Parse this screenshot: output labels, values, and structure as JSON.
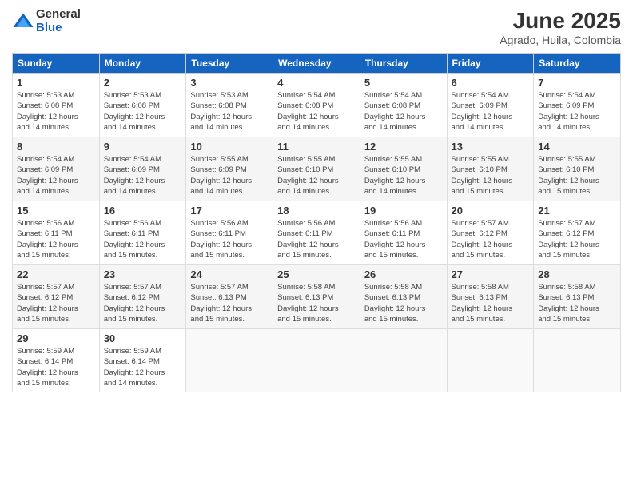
{
  "logo": {
    "general": "General",
    "blue": "Blue"
  },
  "title": {
    "month": "June 2025",
    "location": "Agrado, Huila, Colombia"
  },
  "weekdays": [
    "Sunday",
    "Monday",
    "Tuesday",
    "Wednesday",
    "Thursday",
    "Friday",
    "Saturday"
  ],
  "weeks": [
    [
      {
        "day": "1",
        "sunrise": "5:53 AM",
        "sunset": "6:08 PM",
        "daylight": "12 hours and 14 minutes."
      },
      {
        "day": "2",
        "sunrise": "5:53 AM",
        "sunset": "6:08 PM",
        "daylight": "12 hours and 14 minutes."
      },
      {
        "day": "3",
        "sunrise": "5:53 AM",
        "sunset": "6:08 PM",
        "daylight": "12 hours and 14 minutes."
      },
      {
        "day": "4",
        "sunrise": "5:54 AM",
        "sunset": "6:08 PM",
        "daylight": "12 hours and 14 minutes."
      },
      {
        "day": "5",
        "sunrise": "5:54 AM",
        "sunset": "6:08 PM",
        "daylight": "12 hours and 14 minutes."
      },
      {
        "day": "6",
        "sunrise": "5:54 AM",
        "sunset": "6:09 PM",
        "daylight": "12 hours and 14 minutes."
      },
      {
        "day": "7",
        "sunrise": "5:54 AM",
        "sunset": "6:09 PM",
        "daylight": "12 hours and 14 minutes."
      }
    ],
    [
      {
        "day": "8",
        "sunrise": "5:54 AM",
        "sunset": "6:09 PM",
        "daylight": "12 hours and 14 minutes."
      },
      {
        "day": "9",
        "sunrise": "5:54 AM",
        "sunset": "6:09 PM",
        "daylight": "12 hours and 14 minutes."
      },
      {
        "day": "10",
        "sunrise": "5:55 AM",
        "sunset": "6:09 PM",
        "daylight": "12 hours and 14 minutes."
      },
      {
        "day": "11",
        "sunrise": "5:55 AM",
        "sunset": "6:10 PM",
        "daylight": "12 hours and 14 minutes."
      },
      {
        "day": "12",
        "sunrise": "5:55 AM",
        "sunset": "6:10 PM",
        "daylight": "12 hours and 14 minutes."
      },
      {
        "day": "13",
        "sunrise": "5:55 AM",
        "sunset": "6:10 PM",
        "daylight": "12 hours and 15 minutes."
      },
      {
        "day": "14",
        "sunrise": "5:55 AM",
        "sunset": "6:10 PM",
        "daylight": "12 hours and 15 minutes."
      }
    ],
    [
      {
        "day": "15",
        "sunrise": "5:56 AM",
        "sunset": "6:11 PM",
        "daylight": "12 hours and 15 minutes."
      },
      {
        "day": "16",
        "sunrise": "5:56 AM",
        "sunset": "6:11 PM",
        "daylight": "12 hours and 15 minutes."
      },
      {
        "day": "17",
        "sunrise": "5:56 AM",
        "sunset": "6:11 PM",
        "daylight": "12 hours and 15 minutes."
      },
      {
        "day": "18",
        "sunrise": "5:56 AM",
        "sunset": "6:11 PM",
        "daylight": "12 hours and 15 minutes."
      },
      {
        "day": "19",
        "sunrise": "5:56 AM",
        "sunset": "6:11 PM",
        "daylight": "12 hours and 15 minutes."
      },
      {
        "day": "20",
        "sunrise": "5:57 AM",
        "sunset": "6:12 PM",
        "daylight": "12 hours and 15 minutes."
      },
      {
        "day": "21",
        "sunrise": "5:57 AM",
        "sunset": "6:12 PM",
        "daylight": "12 hours and 15 minutes."
      }
    ],
    [
      {
        "day": "22",
        "sunrise": "5:57 AM",
        "sunset": "6:12 PM",
        "daylight": "12 hours and 15 minutes."
      },
      {
        "day": "23",
        "sunrise": "5:57 AM",
        "sunset": "6:12 PM",
        "daylight": "12 hours and 15 minutes."
      },
      {
        "day": "24",
        "sunrise": "5:57 AM",
        "sunset": "6:13 PM",
        "daylight": "12 hours and 15 minutes."
      },
      {
        "day": "25",
        "sunrise": "5:58 AM",
        "sunset": "6:13 PM",
        "daylight": "12 hours and 15 minutes."
      },
      {
        "day": "26",
        "sunrise": "5:58 AM",
        "sunset": "6:13 PM",
        "daylight": "12 hours and 15 minutes."
      },
      {
        "day": "27",
        "sunrise": "5:58 AM",
        "sunset": "6:13 PM",
        "daylight": "12 hours and 15 minutes."
      },
      {
        "day": "28",
        "sunrise": "5:58 AM",
        "sunset": "6:13 PM",
        "daylight": "12 hours and 15 minutes."
      }
    ],
    [
      {
        "day": "29",
        "sunrise": "5:59 AM",
        "sunset": "6:14 PM",
        "daylight": "12 hours and 15 minutes."
      },
      {
        "day": "30",
        "sunrise": "5:59 AM",
        "sunset": "6:14 PM",
        "daylight": "12 hours and 14 minutes."
      },
      null,
      null,
      null,
      null,
      null
    ]
  ],
  "labels": {
    "sunrise": "Sunrise:",
    "sunset": "Sunset:",
    "daylight": "Daylight:"
  }
}
